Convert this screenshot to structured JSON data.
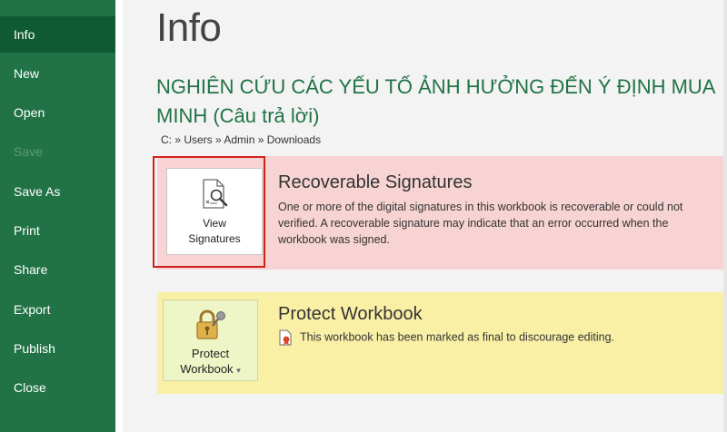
{
  "sidebar": {
    "items": [
      {
        "label": "Info"
      },
      {
        "label": "New"
      },
      {
        "label": "Open"
      },
      {
        "label": "Save"
      },
      {
        "label": "Save As"
      },
      {
        "label": "Print"
      },
      {
        "label": "Share"
      },
      {
        "label": "Export"
      },
      {
        "label": "Publish"
      },
      {
        "label": "Close"
      }
    ],
    "active": "Info",
    "disabled": [
      "Save"
    ]
  },
  "page": {
    "title": "Info",
    "doc_title_line1": "NGHIÊN CỨU CÁC YẾU TỐ ẢNH HƯỞNG ĐẾN Ý ĐỊNH MUA",
    "doc_title_line2": "MINH (Câu trả lời)",
    "breadcrumb": "C: » Users » Admin » Downloads"
  },
  "recoverable": {
    "heading": "Recoverable Signatures",
    "description": "One or more of the digital signatures in this workbook is recoverable or could not verified. A recoverable signature may indicate that an error occurred when the workbook was signed.",
    "button_line1": "View",
    "button_line2": "Signatures",
    "icon": "view-signatures-icon"
  },
  "protect": {
    "heading": "Protect Workbook",
    "note": "This workbook has been marked as final to discourage editing.",
    "button_line1": "Protect",
    "button_line2": "Workbook",
    "button_caret": "▾",
    "icon": "lock-key-icon",
    "note_icon": "final-document-icon"
  },
  "colors": {
    "accent": "#217346",
    "sidebar_active": "#0f5a30",
    "warning_bg": "#f7d3d3",
    "protect_bg": "#f9f0a6",
    "highlight": "#d0211a"
  }
}
